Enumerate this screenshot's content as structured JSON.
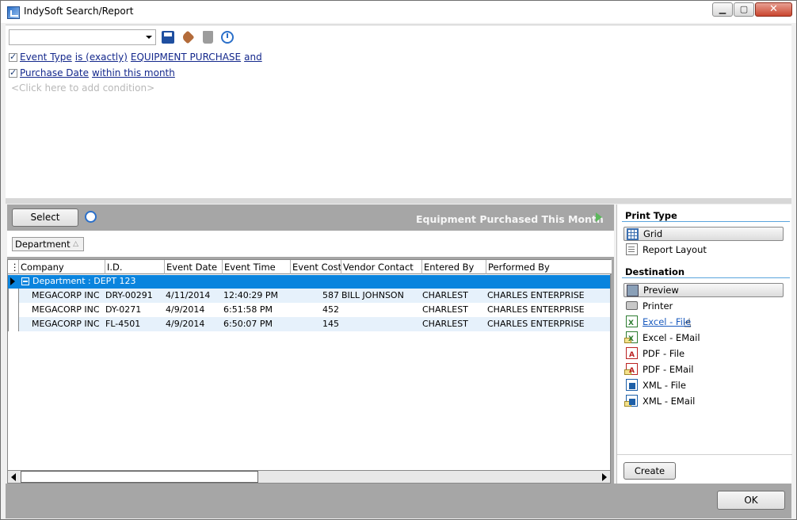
{
  "window": {
    "title": "IndySoft Search/Report"
  },
  "toolbar": {
    "saved_search_value": ""
  },
  "conditions": {
    "line1": {
      "field": "Event Type",
      "operator": "is (exactly)",
      "value": "EQUIPMENT PURCHASE",
      "conj": "and"
    },
    "line2": {
      "field": "Purchase Date",
      "operator": "within this month"
    },
    "add_placeholder": "<Click here to add condition>"
  },
  "results": {
    "select_label": "Select",
    "report_title": "Equipment Purchased This Month",
    "group_by_chip": "Department",
    "columns": [
      "Company",
      "I.D.",
      "Event Date",
      "Event Time",
      "Event Cost",
      "Vendor Contact",
      "Entered By",
      "Performed By"
    ],
    "group_label": "Department : DEPT 123",
    "rows": [
      [
        "MEGACORP INC",
        "DRY-00291",
        "4/11/2014",
        "12:40:29 PM",
        "587",
        "BILL JOHNSON",
        "CHARLEST",
        "CHARLES ENTERPRISE"
      ],
      [
        "MEGACORP INC",
        "DY-0271",
        "4/9/2014",
        "6:51:58 PM",
        "452",
        "",
        "CHARLEST",
        "CHARLES ENTERPRISE"
      ],
      [
        "MEGACORP INC",
        "FL-4501",
        "4/9/2014",
        "6:50:07 PM",
        "145",
        "",
        "CHARLEST",
        "CHARLES ENTERPRISE"
      ]
    ]
  },
  "print_type": {
    "title": "Print Type",
    "options": [
      "Grid",
      "Report Layout"
    ],
    "selected": "Grid"
  },
  "destination": {
    "title": "Destination",
    "options": [
      "Preview",
      "Printer",
      "Excel - File",
      "Excel - EMail",
      "PDF - File",
      "PDF - EMail",
      "XML - File",
      "XML - EMail"
    ],
    "selected": "Preview",
    "hovered": "Excel - File"
  },
  "buttons": {
    "create": "Create",
    "ok": "OK"
  },
  "colors": {
    "group_row": "#0a84de",
    "alt_row": "#e6f1fb",
    "link": "#14288c",
    "section_rule": "#5aa4dd"
  }
}
